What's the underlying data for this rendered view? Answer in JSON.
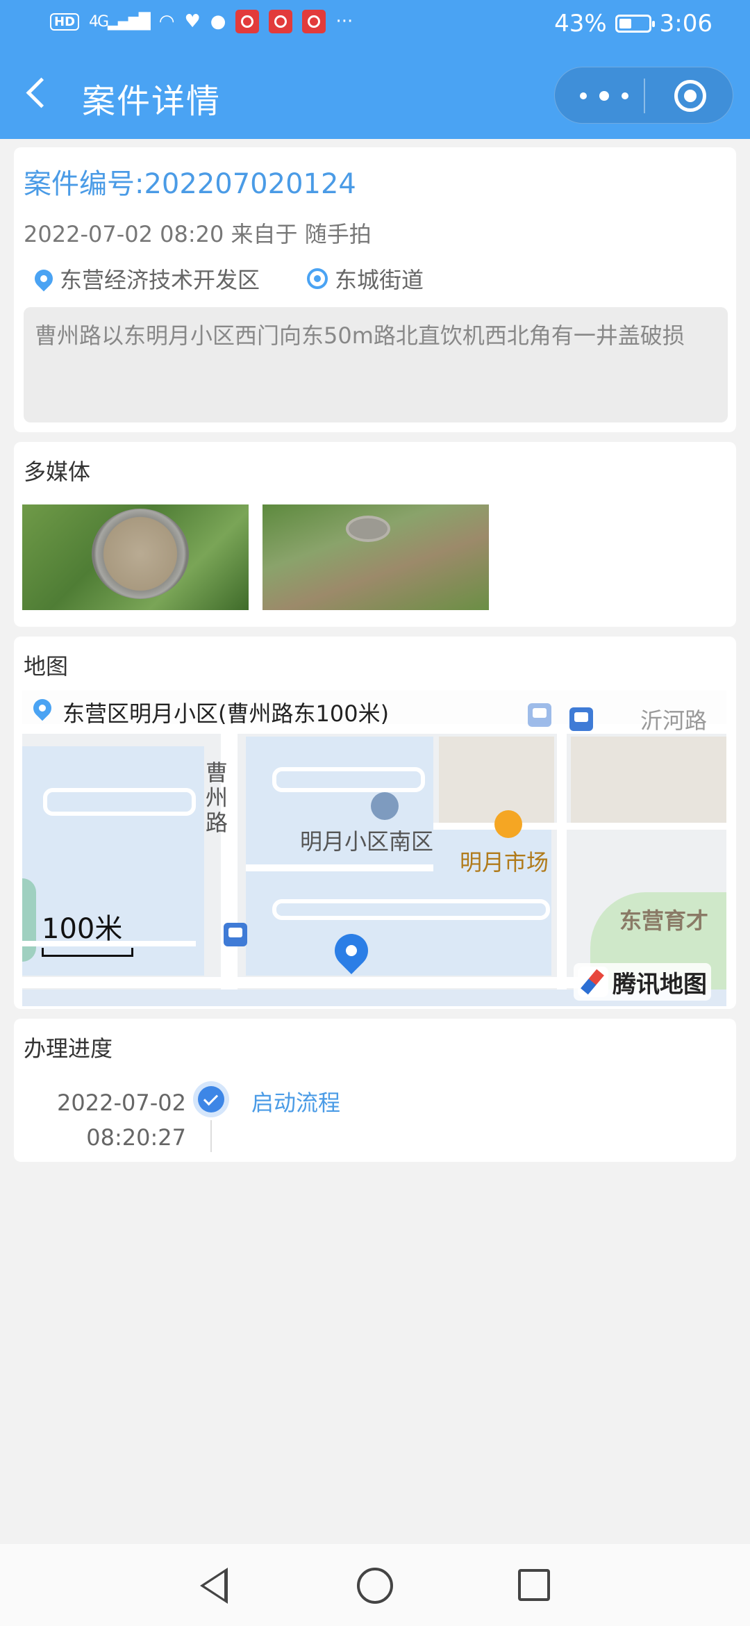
{
  "status_bar": {
    "hd": "HD",
    "network": "4G",
    "more": "···",
    "battery_text": "43%",
    "battery_level": 0.43,
    "time": "3:06"
  },
  "nav": {
    "title": "案件详情"
  },
  "case": {
    "number": "案件编号:202207020124",
    "meta": "2022-07-02 08:20 来自于 随手拍",
    "district": "东营经济技术开发区",
    "street": "东城街道",
    "description": "曹州路以东明月小区西门向东50m路北直饮机西北角有一井盖破损"
  },
  "media": {
    "title": "多媒体",
    "photos": [
      "photo-1",
      "photo-2"
    ]
  },
  "map": {
    "title": "地图",
    "address": "东营区明月小区(曹州路东100米)",
    "labels": {
      "road_caozhou": "曹州路",
      "community": "明月小区南区",
      "market": "明月市场",
      "yihe_road": "沂河路",
      "stadium": "东营育才",
      "scale": "100米",
      "provider": "腾讯地图"
    }
  },
  "progress": {
    "title": "办理进度",
    "steps": [
      {
        "date": "2022-07-02",
        "time": "08:20:27",
        "name": "启动流程"
      }
    ]
  },
  "colors": {
    "primary": "#4aa3f3",
    "link": "#4a9be6"
  }
}
